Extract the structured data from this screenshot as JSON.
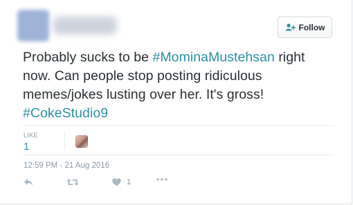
{
  "follow_button": {
    "label": "Follow",
    "icon": "follow-user-icon"
  },
  "tweet": {
    "text_part_1": "Probably sucks to be ",
    "hashtag_1": "#MominaMustehsan",
    "text_part_2": " right now. Can people stop posting ridiculous memes/jokes lusting over her. It's gross! ",
    "hashtag_2": "#CokeStudio9",
    "hashtag_color": "#2a8fa6"
  },
  "stats": {
    "like_label": "LIKE",
    "like_count": "1"
  },
  "timestamp": "12:59 PM - 21 Aug 2016",
  "actions": {
    "reply_icon": "reply-icon",
    "retweet_icon": "retweet-icon",
    "like_icon": "heart-icon",
    "like_count": "1",
    "more_icon": "more-icon"
  }
}
